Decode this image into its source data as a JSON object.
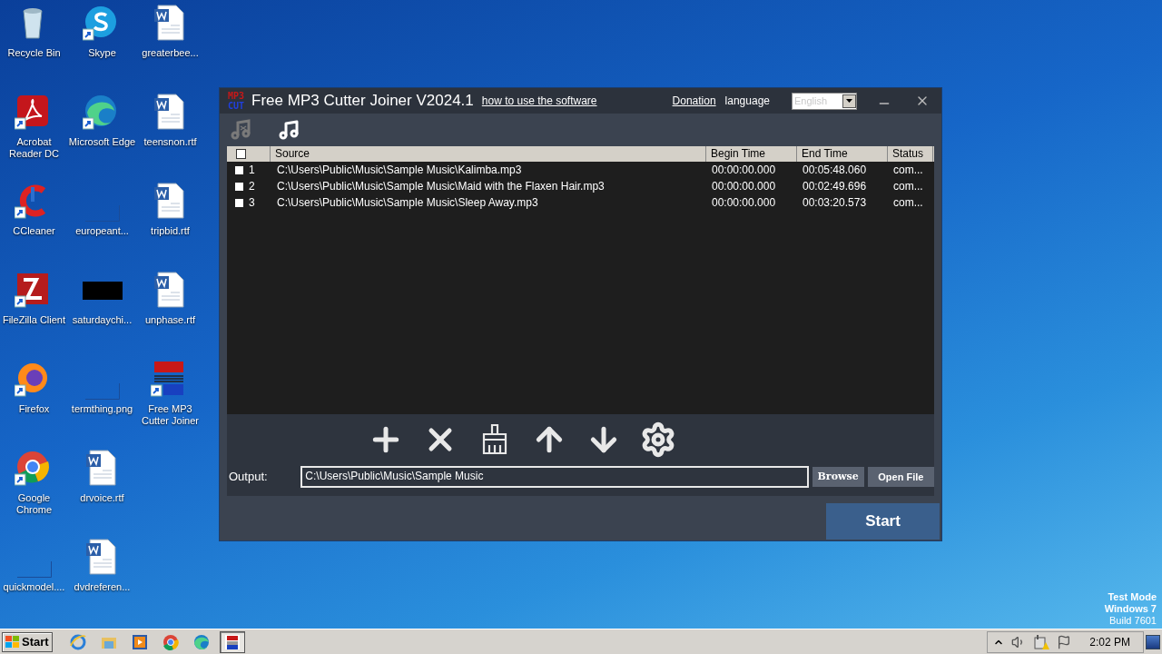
{
  "desktop": {
    "icons": [
      {
        "label": "Recycle Bin",
        "kind": "recycle",
        "shortcut": false
      },
      {
        "label": "Acrobat Reader DC",
        "kind": "acrobat",
        "shortcut": true
      },
      {
        "label": "CCleaner",
        "kind": "ccleaner",
        "shortcut": true
      },
      {
        "label": "FileZilla Client",
        "kind": "filezilla",
        "shortcut": true
      },
      {
        "label": "Firefox",
        "kind": "firefox",
        "shortcut": true
      },
      {
        "label": "Google Chrome",
        "kind": "chrome",
        "shortcut": true
      },
      {
        "label": "quickmodel....",
        "kind": "blank",
        "shortcut": false
      },
      {
        "label": "Skype",
        "kind": "skype",
        "shortcut": true
      },
      {
        "label": "Microsoft Edge",
        "kind": "edge",
        "shortcut": true
      },
      {
        "label": "europeant...",
        "kind": "blank",
        "shortcut": false
      },
      {
        "label": "saturdaychi...",
        "kind": "dark",
        "shortcut": false
      },
      {
        "label": "termthing.png",
        "kind": "blank",
        "shortcut": false
      },
      {
        "label": "drvoice.rtf",
        "kind": "word",
        "shortcut": false
      },
      {
        "label": "dvdreferen...",
        "kind": "word",
        "shortcut": false
      },
      {
        "label": "greaterbee...",
        "kind": "word",
        "shortcut": false
      },
      {
        "label": "teensnon.rtf",
        "kind": "word",
        "shortcut": false
      },
      {
        "label": "tripbid.rtf",
        "kind": "word",
        "shortcut": false
      },
      {
        "label": "unphase.rtf",
        "kind": "word",
        "shortcut": false
      },
      {
        "label": "Free MP3 Cutter Joiner",
        "kind": "mp3",
        "shortcut": true
      }
    ],
    "watermark_lines": [
      "Test Mode",
      "Windows 7",
      "Build 7601"
    ]
  },
  "window": {
    "logo": [
      "MP3",
      "CUT"
    ],
    "title": "Free MP3 Cutter Joiner V2024.1",
    "help_link": "how to use the software",
    "donation_link": "Donation",
    "language_label": "language",
    "language": {
      "value": "English",
      "disabled": true
    },
    "mode_tools": [
      {
        "kind": "cutter",
        "disabled": true
      },
      {
        "kind": "joiner",
        "disabled": false
      }
    ],
    "table": {
      "header_checked": false,
      "columns": [
        "Source",
        "Begin Time",
        "End Time",
        "Status"
      ],
      "rows": [
        {
          "checked": false,
          "index": "1",
          "source": "C:\\Users\\Public\\Music\\Sample Music\\Kalimba.mp3",
          "begin": "00:00:00.000",
          "end": "00:05:48.060",
          "status": "com..."
        },
        {
          "checked": false,
          "index": "2",
          "source": "C:\\Users\\Public\\Music\\Sample Music\\Maid with the Flaxen Hair.mp3",
          "begin": "00:00:00.000",
          "end": "00:02:49.696",
          "status": "com..."
        },
        {
          "checked": false,
          "index": "3",
          "source": "C:\\Users\\Public\\Music\\Sample Music\\Sleep Away.mp3",
          "begin": "00:00:00.000",
          "end": "00:03:20.573",
          "status": "com..."
        }
      ]
    },
    "actions": [
      {
        "kind": "add"
      },
      {
        "kind": "remove"
      },
      {
        "kind": "clear"
      },
      {
        "kind": "up"
      },
      {
        "kind": "down"
      },
      {
        "kind": "settings"
      }
    ],
    "output_label": "Output:",
    "output_value": "C:\\Users\\Public\\Music\\Sample Music",
    "browse": "Browse",
    "open_file": "Open File",
    "start": "Start"
  },
  "taskbar": {
    "start": "Start",
    "apps": [
      {
        "kind": "ie",
        "selected": false
      },
      {
        "kind": "folder",
        "selected": false
      },
      {
        "kind": "media",
        "selected": false
      },
      {
        "kind": "chrome",
        "selected": false
      },
      {
        "kind": "edge",
        "selected": false
      },
      {
        "kind": "mp3",
        "selected": true
      }
    ],
    "time": "2:02 PM"
  }
}
